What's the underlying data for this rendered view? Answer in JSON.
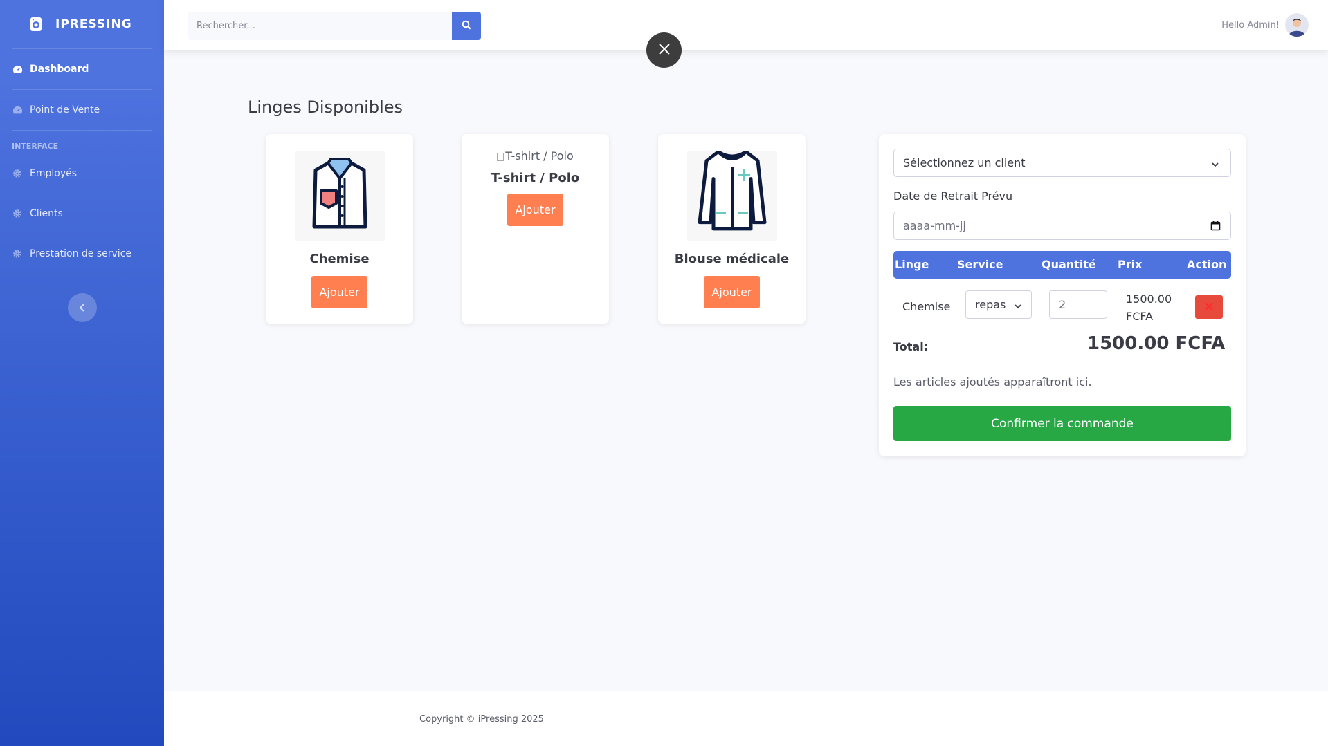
{
  "brand": {
    "name": "IPRESSING"
  },
  "sidebar": {
    "items": [
      {
        "label": "Dashboard"
      },
      {
        "label": "Point de Vente"
      }
    ],
    "heading": "INTERFACE",
    "interface_items": [
      {
        "label": "Employés"
      },
      {
        "label": "Clients"
      },
      {
        "label": "Prestation de service"
      }
    ]
  },
  "topbar": {
    "search_placeholder": "Rechercher...",
    "greeting": "Hello Admin!"
  },
  "main": {
    "title": "Linges Disponibles",
    "cards": [
      {
        "name": "Chemise",
        "button": "Ajouter"
      },
      {
        "alt": "T-shirt / Polo",
        "name": "T-shirt / Polo",
        "button": "Ajouter"
      },
      {
        "name": "Blouse médicale",
        "button": "Ajouter"
      }
    ]
  },
  "order": {
    "client_select": "Sélectionnez un client",
    "date_label": "Date de Retrait Prévu",
    "date_placeholder": "aaaa-mm-jj",
    "columns": [
      "Linge",
      "Service",
      "Quantité",
      "Prix",
      "Action"
    ],
    "rows": [
      {
        "linge": "Chemise",
        "service": "repas",
        "quantite": "2",
        "prix": "1500.00 FCFA"
      }
    ],
    "total_label": "Total:",
    "total_value": "1500.00 FCFA",
    "empty_text": "Les articles ajoutés apparaîtront ici.",
    "confirm_label": "Confirmer la commande"
  },
  "footer": {
    "copyright": "Copyright © iPressing 2025"
  },
  "colors": {
    "primary": "#4e73df",
    "accent": "#ff7f50",
    "success": "#28a745",
    "danger": "#e74a3b"
  }
}
